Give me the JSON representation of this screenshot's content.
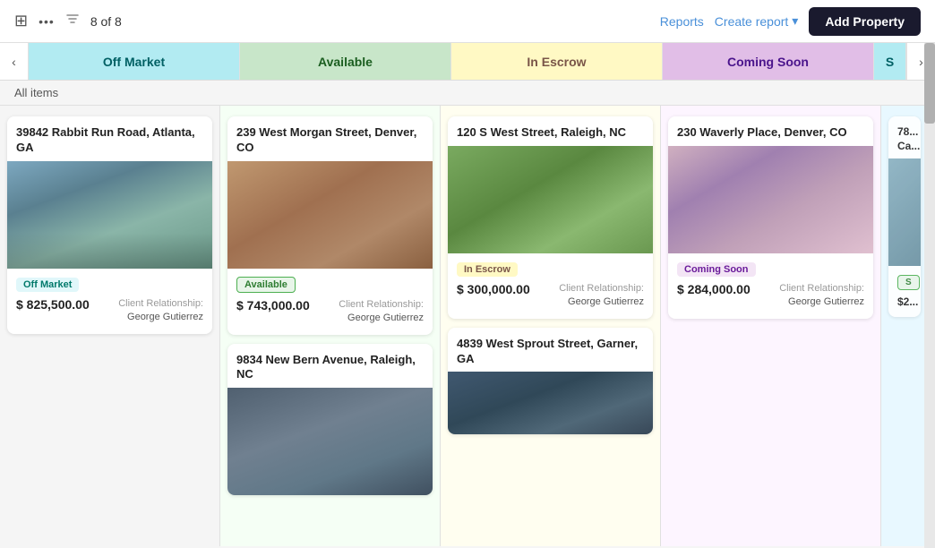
{
  "topbar": {
    "icon_grid": "⊞",
    "icon_more": "···",
    "count": "8 of 8",
    "reports_label": "Reports",
    "create_report_label": "Create report",
    "add_property_label": "Add Property"
  },
  "tabs": [
    {
      "id": "off-market",
      "label": "Off Market",
      "class": "off-market"
    },
    {
      "id": "available",
      "label": "Available",
      "class": "available"
    },
    {
      "id": "in-escrow",
      "label": "In Escrow",
      "class": "in-escrow"
    },
    {
      "id": "coming-soon",
      "label": "Coming Soon",
      "class": "coming-soon"
    },
    {
      "id": "sold",
      "label": "S",
      "class": "sold"
    }
  ],
  "all_items_label": "All items",
  "columns": [
    {
      "id": "off-market",
      "cards": [
        {
          "address": "39842 Rabbit Run Road, Atlanta, GA",
          "image_desc": "House with garage and lawn",
          "image_gradient": "linear-gradient(135deg, #87a9c0 0%, #6b8fa8 50%, #8fb0a8 100%)",
          "status_label": "Off Market",
          "status_class": "badge-off-market",
          "price": "$ 825,500.00",
          "client_label": "Client Relationship:",
          "client_name": "George Gutierrez"
        }
      ]
    },
    {
      "id": "available",
      "cards": [
        {
          "address": "239 West Morgan Street, Denver, CO",
          "image_desc": "Brick building downtown",
          "image_gradient": "linear-gradient(135deg, #b08060 0%, #c09070 50%, #a07050 100%)",
          "status_label": "Available",
          "status_class": "badge-available",
          "price": "$ 743,000.00",
          "client_label": "Client Relationship:",
          "client_name": "George Gutierrez"
        },
        {
          "address": "9834 New Bern Avenue, Raleigh, NC",
          "image_desc": "White house at dusk",
          "image_gradient": "linear-gradient(135deg, #6080a0 0%, #405870 50%, #809090 100%)",
          "status_label": "",
          "status_class": "",
          "price": "",
          "client_label": "",
          "client_name": ""
        }
      ]
    },
    {
      "id": "in-escrow",
      "cards": [
        {
          "address": "120 S West Street, Raleigh, NC",
          "image_desc": "Stone house with landscaping",
          "image_gradient": "linear-gradient(135deg, #6a8a60 0%, #8aaa70 50%, #5a7a50 100%)",
          "status_label": "In Escrow",
          "status_class": "badge-in-escrow",
          "price": "$ 300,000.00",
          "client_label": "Client Relationship:",
          "client_name": "George Gutierrez"
        },
        {
          "address": "4839 West Sprout Street, Garner, GA",
          "image_desc": "House at dusk",
          "image_gradient": "linear-gradient(135deg, #405060 0%, #607080 50%, #304050 100%)",
          "status_label": "",
          "status_class": "",
          "price": "",
          "client_label": "",
          "client_name": ""
        }
      ]
    },
    {
      "id": "coming-soon",
      "cards": [
        {
          "address": "230 Waverly Place, Denver, CO",
          "image_desc": "Modern white house at sunset",
          "image_gradient": "linear-gradient(135deg, #c08090 0%, #9060a0 50%, #d0a0b0 100%)",
          "status_label": "Coming Soon",
          "status_class": "badge-coming-soon",
          "price": "$ 284,000.00",
          "client_label": "Client Relationship:",
          "client_name": "George Gutierrez"
        }
      ]
    },
    {
      "id": "partial",
      "cards": [
        {
          "address": "78...",
          "image_desc": "House",
          "image_gradient": "linear-gradient(135deg, #8ab0c0 0%, #6a90a0 100%)",
          "status_label": "S",
          "status_class": "badge-available",
          "price": "$ 2...",
          "client_label": "",
          "client_name": ""
        }
      ]
    }
  ],
  "scroll_visible": true
}
